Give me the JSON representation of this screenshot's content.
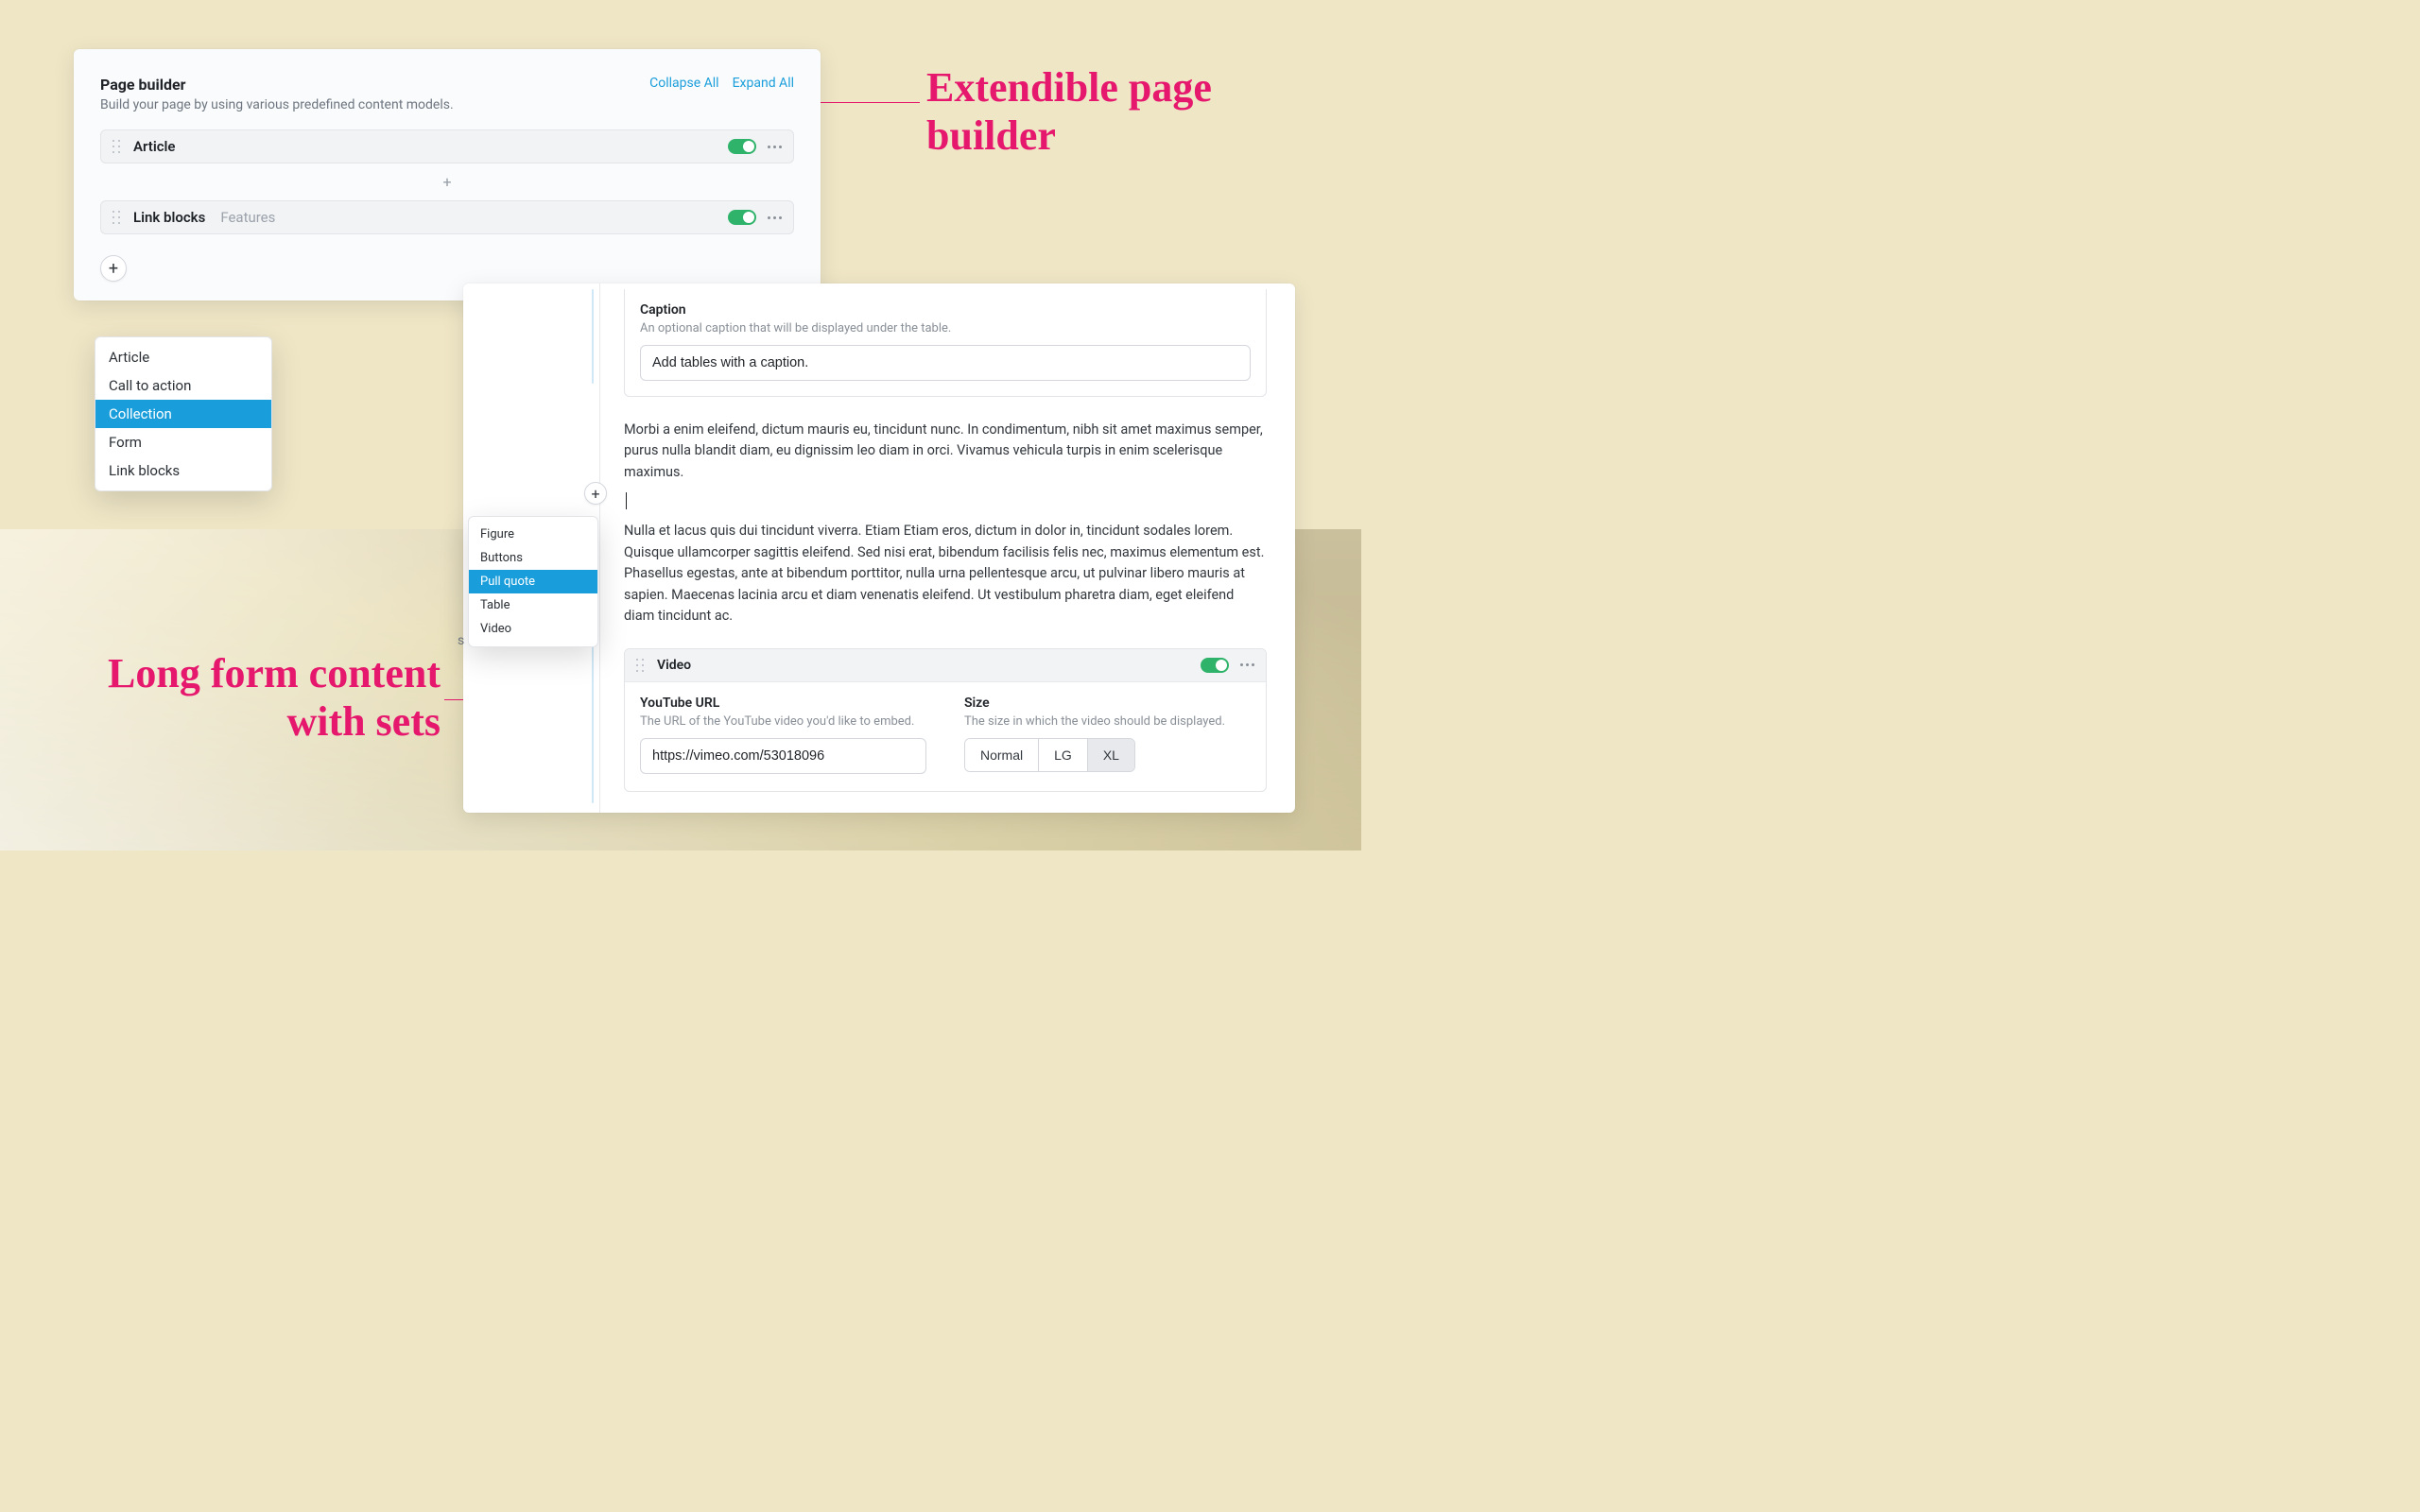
{
  "annotations": {
    "right_line1": "Extendible page",
    "right_line2": "builder",
    "left_line1": "Long form content",
    "left_line2": "with sets"
  },
  "page_builder": {
    "title": "Page builder",
    "description": "Build your page by using various predefined content models.",
    "collapse_all": "Collapse All",
    "expand_all": "Expand All",
    "sets": [
      {
        "label": "Article",
        "sublabel": ""
      },
      {
        "label": "Link blocks",
        "sublabel": "Features"
      }
    ],
    "plus_glyph": "+",
    "add_menu": [
      "Article",
      "Call to action",
      "Collection",
      "Form",
      "Link blocks"
    ],
    "add_menu_selected": "Collection"
  },
  "editor": {
    "caption_label": "Caption",
    "caption_hint": "An optional caption that will be displayed under the table.",
    "caption_value": "Add tables with a caption.",
    "para1": "Morbi a enim eleifend, dictum mauris eu, tincidunt nunc. In condimentum, nibh sit amet maximus semper, purus nulla blandit diam, eu dignissim leo diam in orci. Vivamus vehicula turpis in enim scelerisque maximus.",
    "para2": "Nulla et lacus quis dui tincidunt viverra. Etiam Etiam eros, dictum in dolor in, tincidunt sodales lorem. Quisque ullamcorper sagittis eleifend. Sed nisi erat, bibendum facilisis felis nec, maximus elementum est. Phasellus egestas, ante at bibendum porttitor, nulla urna pellentesque arcu, ut pulvinar libero mauris at sapien. Maecenas lacinia arcu et diam venenatis eleifend. Ut vestibulum pharetra diam, eget eleifend diam tincidunt ac.",
    "insert_menu": [
      "Figure",
      "Buttons",
      "Pull quote",
      "Table",
      "Video"
    ],
    "insert_menu_selected": "Pull quote",
    "video": {
      "set_label": "Video",
      "url_label": "YouTube URL",
      "url_hint": "The URL of the YouTube video you'd like to embed.",
      "url_value": "https://vimeo.com/53018096",
      "size_label": "Size",
      "size_hint": "The size in which the video should be displayed.",
      "size_options": [
        "Normal",
        "LG",
        "XL"
      ],
      "size_selected": "XL"
    },
    "stray_char": "s"
  }
}
